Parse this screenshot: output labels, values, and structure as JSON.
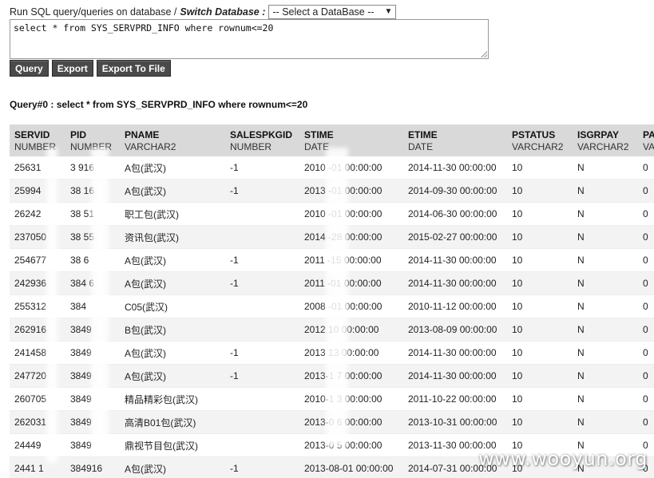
{
  "toolbar": {
    "prompt": "Run SQL query/queries on database /",
    "switch_label": "Switch Database :",
    "db_select_value": "-- Select a DataBase --"
  },
  "sql": {
    "text": "select * from SYS_SERVPRD_INFO where rownum<=20"
  },
  "buttons": {
    "query": "Query",
    "export": "Export",
    "export_file": "Export To File"
  },
  "query_caption": "Query#0 : select * from SYS_SERVPRD_INFO where rownum<=20",
  "table": {
    "columns": [
      {
        "name": "SERVID",
        "type": "NUMBER"
      },
      {
        "name": "PID",
        "type": "NUMBER"
      },
      {
        "name": "PNAME",
        "type": "VARCHAR2"
      },
      {
        "name": "SALESPKGID",
        "type": "NUMBER"
      },
      {
        "name": "STIME",
        "type": "DATE"
      },
      {
        "name": "ETIME",
        "type": "DATE"
      },
      {
        "name": "PSTATUS",
        "type": "VARCHAR2"
      },
      {
        "name": "ISGRPAY",
        "type": "VARCHAR2"
      },
      {
        "name": "PA",
        "type": "VA"
      }
    ],
    "rows": [
      [
        "25631",
        "3 916",
        "A包(武汉)",
        "-1",
        "2010 -01 00:00:00",
        "2014-11-30 00:00:00",
        "10",
        "N",
        "0"
      ],
      [
        "25994",
        "38 16",
        "A包(武汉)",
        "-1",
        "2013 -01 00:00:00",
        "2014-09-30 00:00:00",
        "10",
        "N",
        "0"
      ],
      [
        "26242",
        "38 51",
        "职工包(武汉)",
        "",
        "2010 -01 00:00:00",
        "2014-06-30 00:00:00",
        "10",
        "N",
        "0"
      ],
      [
        "237050",
        "38 55",
        "资讯包(武汉)",
        "",
        "2014 -28 00:00:00",
        "2015-02-27 00:00:00",
        "10",
        "N",
        "0"
      ],
      [
        "254677",
        "38 6",
        "A包(武汉)",
        "-1",
        "2011 -15 00:00:00",
        "2014-11-30 00:00:00",
        "10",
        "N",
        "0"
      ],
      [
        "242936",
        "384 6",
        "A包(武汉)",
        "-1",
        "2011 -01 00:00:00",
        "2014-11-30 00:00:00",
        "10",
        "N",
        "0"
      ],
      [
        "255312",
        "384",
        "C05(武汉)",
        "",
        "2008 -01 00:00:00",
        "2010-11-12 00:00:00",
        "10",
        "N",
        "0"
      ],
      [
        "262916",
        "3849",
        "B包(武汉)",
        "",
        "2012 10 00:00:00",
        "2013-08-09 00:00:00",
        "10",
        "N",
        "0"
      ],
      [
        "241458",
        "3849",
        "A包(武汉)",
        "-1",
        "2013 13 00:00:00",
        "2014-11-30 00:00:00",
        "10",
        "N",
        "0"
      ],
      [
        "247720",
        "3849",
        "A包(武汉)",
        "-1",
        "2013-1 7 00:00:00",
        "2014-11-30 00:00:00",
        "10",
        "N",
        "0"
      ],
      [
        "260705",
        "3849",
        "精品精彩包(武汉)",
        "",
        "2010-1 3 00:00:00",
        "2011-10-22 00:00:00",
        "10",
        "N",
        "0"
      ],
      [
        "262031",
        "3849",
        "高清B01包(武汉)",
        "",
        "2013-0 6 00:00:00",
        "2013-10-31 00:00:00",
        "10",
        "N",
        "0"
      ],
      [
        "24449",
        "3849",
        "鼎视节目包(武汉)",
        "",
        "2013-0 5 00:00:00",
        "2013-11-30 00:00:00",
        "10",
        "N",
        "0"
      ],
      [
        "2441 1",
        "384916",
        "A包(武汉)",
        "-1",
        "2013-08-01 00:00:00",
        "2014-07-31 00:00:00",
        "10",
        "N",
        "0"
      ]
    ]
  },
  "watermark": "www.wooyun.org"
}
